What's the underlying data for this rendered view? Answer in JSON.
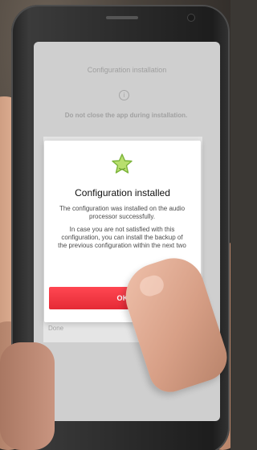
{
  "screen": {
    "title": "Configuration installation",
    "warning": "Do not close the app during installation.",
    "done": "Done"
  },
  "modal": {
    "title": "Configuration installed",
    "body_1": "The configuration was installed on the audio processor successfully.",
    "body_2": "In case you are not satisfied with this configuration, you can install the backup of the previous configuration within the next two",
    "ok_label": "OK"
  },
  "icons": {
    "info": "info-icon",
    "success": "star-icon"
  },
  "colors": {
    "accent": "#e52a36",
    "success": "#8ac53f"
  }
}
